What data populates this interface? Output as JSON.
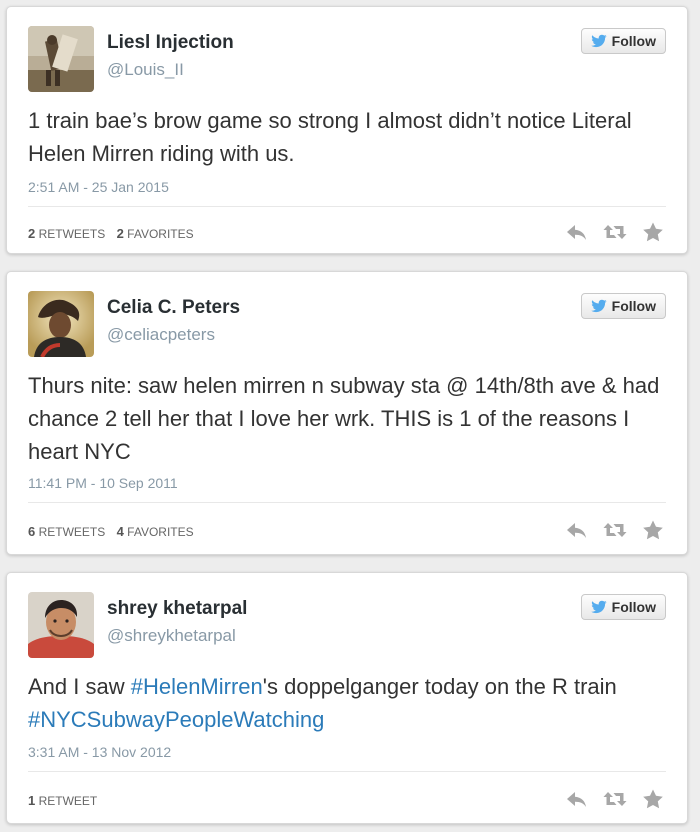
{
  "colors": {
    "hashtag": "#2b7bb9",
    "bird": "#55acee",
    "muted": "#8899a6",
    "action_icon": "#a7a7a7"
  },
  "icons": {
    "follow": "twitter-bird-icon",
    "reply": "reply-icon",
    "retweet": "retweet-icon",
    "favorite": "star-icon"
  },
  "tweets": [
    {
      "name": "Liesl Injection",
      "handle": "@Louis_II",
      "follow_label": "Follow",
      "text": "1 train bae’s brow game so strong I almost didn’t notice Literal Helen Mirren riding with us.",
      "date": "2:51 AM - 25 Jan 2015",
      "retweets_count": "2",
      "retweets_label": "RETWEETS",
      "favorites_count": "2",
      "favorites_label": "FAVORITES"
    },
    {
      "name": "Celia C. Peters",
      "handle": "@celiacpeters",
      "follow_label": "Follow",
      "text": "Thurs nite: saw helen mirren n subway sta @ 14th/8th ave & had chance 2 tell her that I love her wrk. THIS is 1 of the reasons I heart NYC",
      "date": "11:41 PM - 10 Sep 2011",
      "retweets_count": "6",
      "retweets_label": "RETWEETS",
      "favorites_count": "4",
      "favorites_label": "FAVORITES"
    },
    {
      "name": "shrey khetarpal",
      "handle": "@shreykhetarpal",
      "follow_label": "Follow",
      "text_before": "And I saw ",
      "hashtag_1": "#HelenMirren",
      "text_middle": "'s doppelganger today on the R train ",
      "hashtag_2": "#NYCSubwayPeopleWatching",
      "date": "3:31 AM - 13 Nov 2012",
      "retweets_count": "1",
      "retweets_label": "RETWEET"
    }
  ]
}
